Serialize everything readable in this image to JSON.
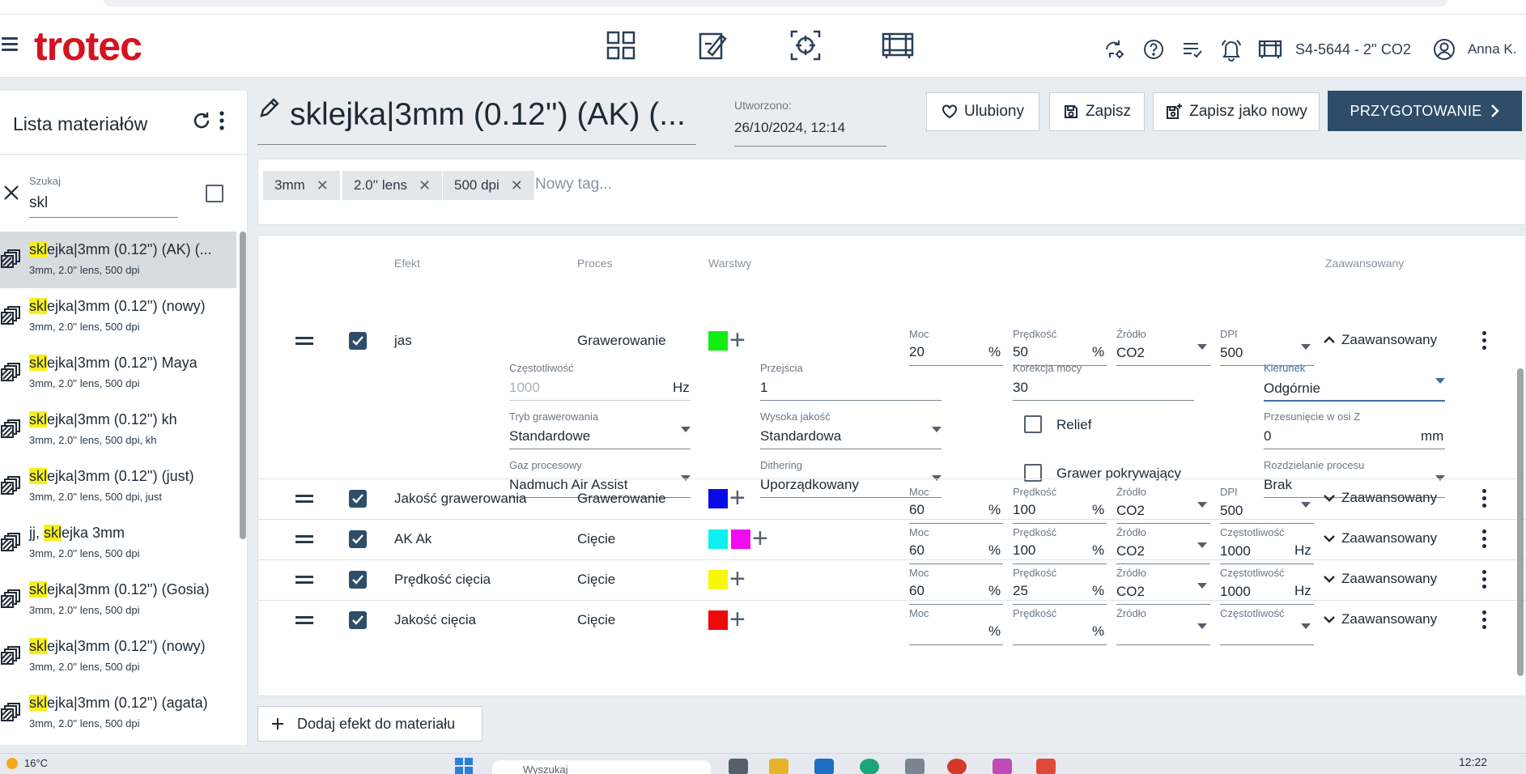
{
  "header": {
    "logo": "trotec",
    "machine": "S4-5644 - 2'' CO2",
    "user": "Anna K.",
    "center_icons": [
      "grid-icon",
      "edit-design-icon",
      "focus-target-icon",
      "machine-bed-icon"
    ],
    "right_icons": [
      "sync-settings-icon",
      "help-icon",
      "job-list-icon",
      "notifications-icon",
      "machine-icon",
      "user-avatar-icon"
    ]
  },
  "sidebar": {
    "title": "Lista materiałów",
    "search_label": "Szukaj",
    "search_value": "skl",
    "items": [
      {
        "hl": "skl",
        "rest": "ejka|3mm (0.12'') (AK) (...",
        "sub": "3mm, 2.0'' lens, 500 dpi"
      },
      {
        "hl": "skl",
        "rest": "ejka|3mm (0.12'') (nowy)",
        "sub": "3mm, 2.0'' lens, 500 dpi"
      },
      {
        "hl": "skl",
        "rest": "ejka|3mm (0.12'') Maya",
        "sub": "3mm, 2.0'' lens, 500 dpi"
      },
      {
        "hl": "skl",
        "rest": "ejka|3mm (0.12'') kh",
        "sub": "3mm, 2.0'' lens, 500 dpi, kh"
      },
      {
        "hl": "skl",
        "rest": "ejka|3mm (0.12'') (just)",
        "sub": "3mm, 2.0'' lens, 500 dpi, just"
      },
      {
        "pre": "jj, ",
        "hl": "skl",
        "rest": "ejka 3mm",
        "sub": "3mm, 2.0'' lens, 500 dpi"
      },
      {
        "hl": "skl",
        "rest": "ejka|3mm (0.12'') (Gosia)",
        "sub": "3mm, 2.0'' lens, 500 dpi"
      },
      {
        "hl": "skl",
        "rest": "ejka|3mm (0.12'') (nowy)",
        "sub": "3mm, 2.0'' lens, 500 dpi"
      },
      {
        "hl": "skl",
        "rest": "ejka|3mm (0.12'') (agata)",
        "sub": "3mm, 2.0'' lens, 500 dpi"
      }
    ]
  },
  "material": {
    "title": "sklejka|3mm (0.12'') (AK) (...",
    "created_label": "Utworzono:",
    "created_value": "26/10/2024, 12:14"
  },
  "toolbar": {
    "favorite": "Ulubiony",
    "save": "Zapisz",
    "save_as_new": "Zapisz jako nowy",
    "prepare": "PRZYGOTOWANIE"
  },
  "tags": {
    "items": [
      "3mm",
      "2.0'' lens",
      "500 dpi"
    ],
    "placeholder": "Nowy tag..."
  },
  "effects": {
    "headers": {
      "effect": "Efekt",
      "process": "Proces",
      "layers": "Warstwy",
      "advanced": "Zaawansowany"
    },
    "field_labels": {
      "power": "Moc",
      "speed": "Prędkość",
      "source": "Źródło",
      "dpi": "DPI",
      "frequency": "Częstotliwość"
    },
    "advanced_label": "Zaawansowany",
    "rows": [
      {
        "name": "jas",
        "process": "Grawerowanie",
        "colors": [
          "#11ee11"
        ],
        "power": "20",
        "speed": "50",
        "source": "CO2",
        "last_label": "DPI",
        "last_value": "500",
        "last_unit": ""
      },
      {
        "name": "Jakość grawerowania",
        "process": "Grawerowanie",
        "colors": [
          "#0a0ae8"
        ],
        "power": "60",
        "speed": "100",
        "source": "CO2",
        "last_label": "DPI",
        "last_value": "500",
        "last_unit": ""
      },
      {
        "name": "AK Ak",
        "process": "Cięcie",
        "colors": [
          "#0df0f0",
          "#f00af0"
        ],
        "power": "60",
        "speed": "100",
        "source": "CO2",
        "last_label": "Częstotliwość",
        "last_value": "1000",
        "last_unit": "Hz"
      },
      {
        "name": "Prędkość cięcia",
        "process": "Cięcie",
        "colors": [
          "#f7f70a"
        ],
        "power": "60",
        "speed": "25",
        "source": "CO2",
        "last_label": "Częstotliwość",
        "last_value": "1000",
        "last_unit": "Hz"
      },
      {
        "name": "Jakość cięcia",
        "process": "Cięcie",
        "colors": [
          "#ee0a0a"
        ],
        "power": "",
        "speed": "",
        "source": "",
        "last_label": "Częstotliwość",
        "last_value": "",
        "last_unit": ""
      }
    ],
    "expanded": {
      "frequency_label": "Częstotliwość",
      "frequency_value": "1000",
      "frequency_unit": "Hz",
      "passes_label": "Przejścia",
      "passes_value": "1",
      "power_corr_label": "Korekcja mocy",
      "power_corr_value": "30",
      "direction_label": "Kierunek",
      "direction_value": "Odgórnie",
      "engrave_mode_label": "Tryb grawerowania",
      "engrave_mode_value": "Standardowe",
      "hq_label": "Wysoka jakość",
      "hq_value": "Standardowa",
      "relief": "Relief",
      "zshift_label": "Przesunięcie w osi Z",
      "zshift_value": "0",
      "zshift_unit": "mm",
      "gas_label": "Gaz procesowy",
      "gas_value": "Nadmuch Air Assist",
      "dithering_label": "Dithering",
      "dithering_value": "Uporządkowany",
      "overlap": "Grawer pokrywający",
      "split_label": "Rozdzielanie procesu",
      "split_value": "Brak"
    },
    "add_effect": "Dodaj efekt do materiału"
  },
  "taskbar": {
    "temperature": "16°C",
    "search_placeholder": "Wyszukaj",
    "time": "12:22"
  },
  "colors": {
    "brand_red": "#d5121f",
    "primary": "#2f4d69",
    "highlight": "#f7ef1a"
  }
}
